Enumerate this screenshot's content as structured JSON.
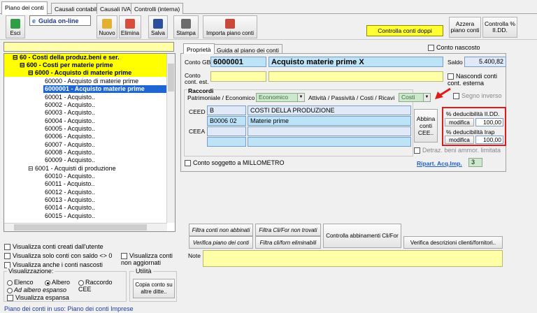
{
  "tabs": [
    {
      "label": "Piano dei conti",
      "active": true
    },
    {
      "label": "Causali contabili"
    },
    {
      "label": "Causali IVA"
    },
    {
      "label": "Controlli (interna)"
    }
  ],
  "toolbar": {
    "exit": "Esci",
    "guide": "Guida on-line",
    "new": "Nuovo",
    "delete": "Elimina",
    "save": "Salva",
    "print": "Stampa",
    "import": "Importa piano conti",
    "check_double": "Controlla conti doppi",
    "reset": "Azzera piano conti",
    "check_pct": "Controlla % II.DD."
  },
  "tree": {
    "rows": [
      "60 - Costi della produz.beni e ser.",
      "600 - Costi per materie prime",
      "6000 - Acquisto di materie prime",
      "60000 - Acquisto di materie prime",
      "6000001 - Acquisto materie prime",
      "60001 - Acquisto..",
      "60002 - Acquisto..",
      "60003 - Acquisto..",
      "60004 - Acquisto..",
      "60005 - Acquisto..",
      "60006 - Acquisto..",
      "60007 - Acquisto..",
      "60008 - Acquisto..",
      "60009 - Acquisto..",
      "6001 - Acquisti di produzione",
      "60010 - Acquisto..",
      "60011 - Acquisto..",
      "60012 - Acquisto..",
      "60013 - Acquisto..",
      "60014 - Acquisto..",
      "60015 - Acquisto.."
    ]
  },
  "options": {
    "user_created": "Visualizza conti creati dall'utente",
    "balance_nonzero": "Visualizza solo conti con saldo <> 0",
    "show_hidden": "Visualizza anche i conti nascosti",
    "not_updated": "Visualizza conti non aggiornati",
    "view_group": "Visualizzazione:",
    "view_list": "Elenco",
    "view_tree": "Albero",
    "view_cee": "Raccordo CEE",
    "expanded_tree": "Ad albero espanso",
    "expanded_view": "Visualizza espansa",
    "utility_group": "Utilità",
    "copy_account": "Copia conto su altre ditte..",
    "footer": "Piano dei conti in uso: Piano dei conti Imprese"
  },
  "detail": {
    "tab_props": "Proprietà",
    "tab_guide": "Guida al piano dei conti",
    "hidden_account": "Conto nascosto",
    "conto_gb_label": "Conto GB",
    "conto_gb_code": "6000001",
    "conto_gb_desc": "Acquisto materie prime X",
    "saldo_label": "Saldo",
    "saldo_value": "5.400,82",
    "ext_label": "Conto cont. est.",
    "hide_ext": "Nascondi conti cont. esterna",
    "raccordi_title": "Raccordi",
    "patrimoniale_label": "Patrimoniale / Economico",
    "patrimoniale_value": "Economico",
    "attivita_label": "Attività / Passività / Costi / Ricavi",
    "attivita_value": "Costi",
    "segno_inverso": "Segno inverso",
    "ceed_label": "CEED",
    "ceea_label": "CEEA",
    "ceed_code": "B",
    "ceed_desc": "COSTI DELLA PRODUZIONE",
    "ceed_code2": "B0006 02",
    "ceed_desc2": "Materie prime",
    "abbina_btn": "Abbina conti CEE..",
    "ded_iidd_label": "% deducibilità II.DD.",
    "ded_irap_label": "% deducibilità Irap",
    "modifica": "modifica",
    "ded_iidd_value": "100,00",
    "ded_irap_value": "100,00",
    "detraz": "Detraz. beni ammor. limitata",
    "millimetro": "Conto soggetto a MILLOMETRO",
    "ripart_label": "Ripart. Acq.Imp.",
    "ripart_value": "3"
  },
  "actions": {
    "filtra_non_abbinati": "Filtra conti non abbinati",
    "filtra_clifor": "Filtra Cli/For non trovati",
    "controlla_abbinamenti": "Controlla abbinamenti Cli/For",
    "verifica_piano": "Verifica piano dei conti",
    "filtra_eliminabili": "Filtra cli/forn eliminabili",
    "verifica_descrizioni": "Verifica descrizioni clienti/fornitori..",
    "note_label": "Note"
  }
}
